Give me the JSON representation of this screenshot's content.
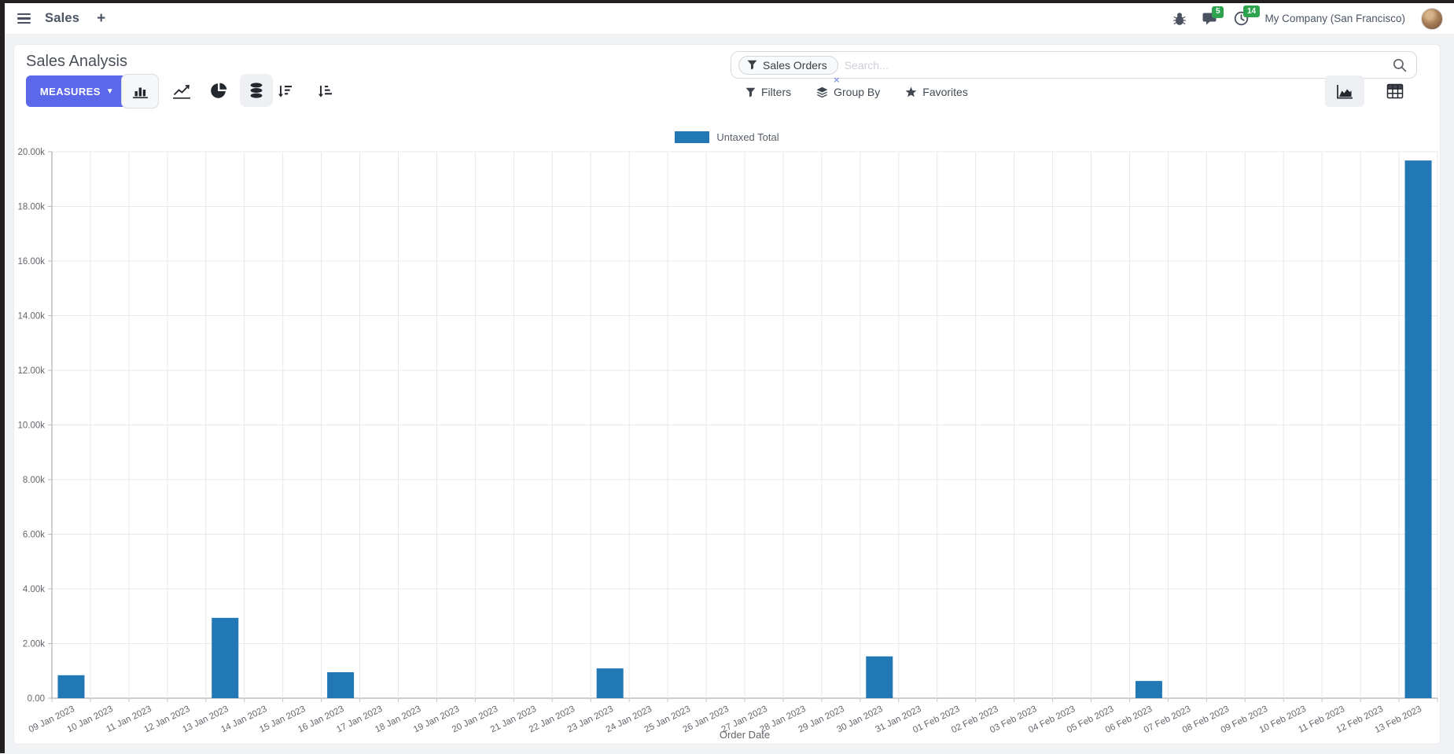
{
  "colors": {
    "accent": "#5b68e9",
    "bar_blue": "#2277b5",
    "badge_green": "#2fa44f",
    "window_edge": "#231f20"
  },
  "navbar": {
    "app_name": "Sales",
    "plus_label": "+",
    "badges": {
      "messages": "5",
      "activities": "14"
    },
    "company": "My Company (San Francisco)"
  },
  "control_panel": {
    "title": "Sales Analysis",
    "measures_label": "MEASURES",
    "view_icons": [
      "bar-chart",
      "line-chart",
      "pie-chart",
      "stacked",
      "sort-descending",
      "sort-ascending"
    ],
    "search": {
      "facet_label": "Sales Orders",
      "placeholder": "Search...",
      "remove_label": "×"
    },
    "menus": [
      {
        "label": "Filters"
      },
      {
        "label": "Group By"
      },
      {
        "label": "Favorites"
      }
    ],
    "view_switcher": [
      "graph",
      "pivot"
    ]
  },
  "chart_data": {
    "type": "bar",
    "title": "",
    "xlabel": "Order Date",
    "ylabel": "",
    "grid": true,
    "legend_position": "top-center",
    "ylim": [
      0,
      20000
    ],
    "ytick_step": 2000,
    "categories": [
      "09 Jan 2023",
      "10 Jan 2023",
      "11 Jan 2023",
      "12 Jan 2023",
      "13 Jan 2023",
      "14 Jan 2023",
      "15 Jan 2023",
      "16 Jan 2023",
      "17 Jan 2023",
      "18 Jan 2023",
      "19 Jan 2023",
      "20 Jan 2023",
      "21 Jan 2023",
      "22 Jan 2023",
      "23 Jan 2023",
      "24 Jan 2023",
      "25 Jan 2023",
      "26 Jan 2023",
      "27 Jan 2023",
      "28 Jan 2023",
      "29 Jan 2023",
      "30 Jan 2023",
      "31 Jan 2023",
      "01 Feb 2023",
      "02 Feb 2023",
      "03 Feb 2023",
      "04 Feb 2023",
      "05 Feb 2023",
      "06 Feb 2023",
      "07 Feb 2023",
      "08 Feb 2023",
      "09 Feb 2023",
      "10 Feb 2023",
      "11 Feb 2023",
      "12 Feb 2023",
      "13 Feb 2023"
    ],
    "series": [
      {
        "name": "Untaxed Total",
        "color": "#2277b5",
        "values": [
          840,
          0,
          0,
          0,
          2940,
          0,
          0,
          950,
          0,
          0,
          0,
          0,
          0,
          0,
          1090,
          0,
          0,
          0,
          0,
          0,
          0,
          1530,
          0,
          0,
          0,
          0,
          0,
          0,
          630,
          0,
          0,
          0,
          0,
          0,
          0,
          19680
        ]
      }
    ]
  }
}
